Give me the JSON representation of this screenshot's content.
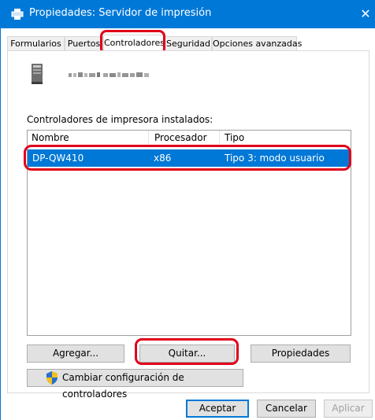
{
  "window": {
    "title": "Propiedades: Servidor de impresión",
    "close_glyph": "✕"
  },
  "tabs": [
    {
      "label": "Formularios"
    },
    {
      "label": "Puertos"
    },
    {
      "label": "Controladores"
    },
    {
      "label": "Seguridad"
    },
    {
      "label": "Opciones avanzadas"
    }
  ],
  "panel": {
    "section_label": "Controladores de impresora instalados:",
    "columns": [
      "Nombre",
      "Procesador",
      "Tipo"
    ],
    "rows": [
      {
        "name": "DP-QW410",
        "processor": "x86",
        "type": "Tipo 3: modo usuario"
      }
    ]
  },
  "buttons": {
    "agregar": "Agregar...",
    "quitar": "Quitar...",
    "propiedades": "Propiedades",
    "cambiar": "Cambiar configuración de controladores"
  },
  "footer": {
    "aceptar": "Aceptar",
    "cancelar": "Cancelar",
    "aplicar": "Aplicar"
  },
  "colors": {
    "accent": "#0078d7",
    "highlight_annotation": "#e0001a"
  },
  "icons": [
    "printer-icon",
    "server-icon",
    "uac-shield-icon"
  ]
}
